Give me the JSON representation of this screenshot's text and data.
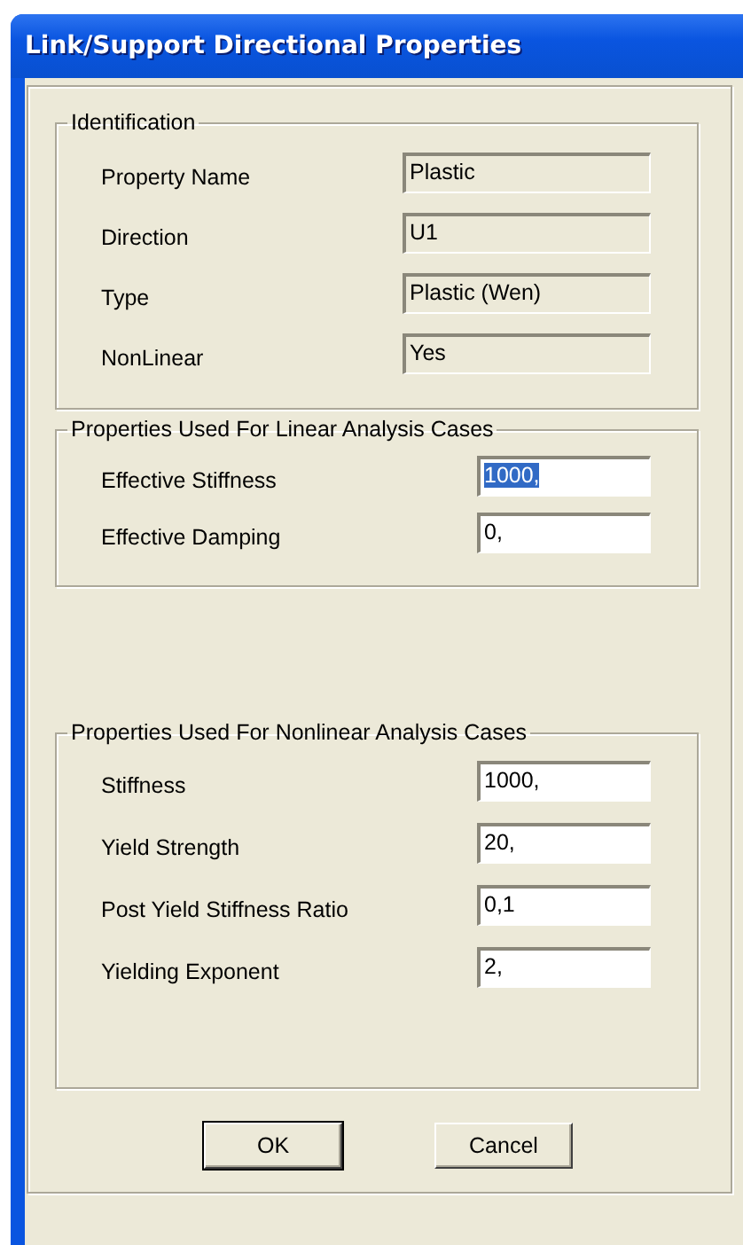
{
  "window": {
    "title": "Link/Support Directional Properties"
  },
  "groups": [
    {
      "title": "Identification",
      "fields": [
        {
          "label": "Property Name",
          "value": "Plastic",
          "kind": "readonly"
        },
        {
          "label": "Direction",
          "value": "U1",
          "kind": "readonly"
        },
        {
          "label": "Type",
          "value": "Plastic (Wen)",
          "kind": "readonly"
        },
        {
          "label": "NonLinear",
          "value": "Yes",
          "kind": "readonly"
        }
      ]
    },
    {
      "title": "Properties Used For Linear Analysis Cases",
      "fields": [
        {
          "label": "Effective Stiffness",
          "value": "1000,",
          "kind": "edit",
          "highlighted": true
        },
        {
          "label": "Effective Damping",
          "value": "0,",
          "kind": "edit",
          "highlighted": false
        }
      ]
    },
    {
      "title": "Properties Used For Nonlinear Analysis Cases",
      "fields": [
        {
          "label": "Stiffness",
          "value": "1000,",
          "kind": "edit",
          "highlighted": false
        },
        {
          "label": "Yield Strength",
          "value": "20,",
          "kind": "edit",
          "highlighted": false
        },
        {
          "label": "Post Yield Stiffness Ratio",
          "value": "0,1",
          "kind": "edit",
          "highlighted": false
        },
        {
          "label": "Yielding Exponent",
          "value": "2,",
          "kind": "edit",
          "highlighted": false
        }
      ]
    }
  ],
  "buttons": [
    {
      "label": "OK",
      "default": true
    },
    {
      "label": "Cancel",
      "default": false
    }
  ]
}
